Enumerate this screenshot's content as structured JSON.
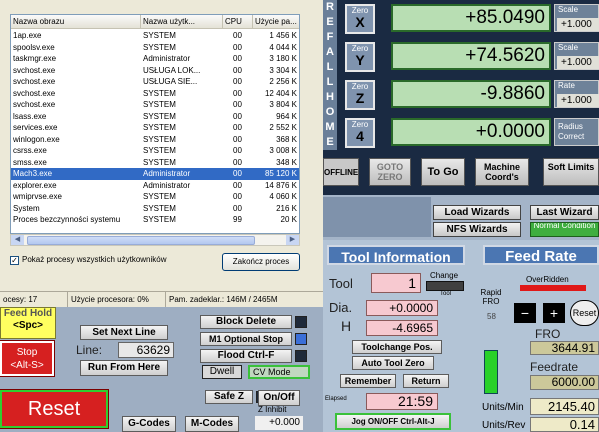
{
  "task_manager": {
    "columns": [
      "Nazwa obrazu",
      "Nazwa użytk...",
      "CPU",
      "Użycie pa..."
    ],
    "processes": [
      {
        "name": "1ap.exe",
        "user": "SYSTEM",
        "cpu": "00",
        "mem": "1 456 K"
      },
      {
        "name": "spoolsv.exe",
        "user": "SYSTEM",
        "cpu": "00",
        "mem": "4 044 K"
      },
      {
        "name": "taskmgr.exe",
        "user": "Administrator",
        "cpu": "00",
        "mem": "3 180 K"
      },
      {
        "name": "svchost.exe",
        "user": "USŁUGA LOK...",
        "cpu": "00",
        "mem": "3 304 K"
      },
      {
        "name": "svchost.exe",
        "user": "USŁUGA SIE...",
        "cpu": "00",
        "mem": "2 256 K"
      },
      {
        "name": "svchost.exe",
        "user": "SYSTEM",
        "cpu": "00",
        "mem": "12 404 K"
      },
      {
        "name": "svchost.exe",
        "user": "SYSTEM",
        "cpu": "00",
        "mem": "3 804 K"
      },
      {
        "name": "lsass.exe",
        "user": "SYSTEM",
        "cpu": "00",
        "mem": "964 K"
      },
      {
        "name": "services.exe",
        "user": "SYSTEM",
        "cpu": "00",
        "mem": "2 552 K"
      },
      {
        "name": "winlogon.exe",
        "user": "SYSTEM",
        "cpu": "00",
        "mem": "368 K"
      },
      {
        "name": "csrss.exe",
        "user": "SYSTEM",
        "cpu": "00",
        "mem": "3 008 K"
      },
      {
        "name": "smss.exe",
        "user": "SYSTEM",
        "cpu": "00",
        "mem": "348 K"
      },
      {
        "name": "Mach3.exe",
        "user": "Administrator",
        "cpu": "00",
        "mem": "85 120 K",
        "selected": true
      },
      {
        "name": "explorer.exe",
        "user": "Administrator",
        "cpu": "00",
        "mem": "14 876 K"
      },
      {
        "name": "wmiprvse.exe",
        "user": "SYSTEM",
        "cpu": "00",
        "mem": "4 060 K"
      },
      {
        "name": "System",
        "user": "SYSTEM",
        "cpu": "00",
        "mem": "216 K"
      },
      {
        "name": "Proces bezczynności systemu",
        "user": "SYSTEM",
        "cpu": "99",
        "mem": "20 K"
      }
    ],
    "show_all_label": "Pokaż procesy wszystkich użytkowników",
    "show_all_checked": "✓",
    "end_process_label": "Zakończ proces",
    "status": {
      "processes": "ocesy: 17",
      "cpu_usage": "Użycie procesora: 0%",
      "memory": "Pam. zadeklar.: 146M / 2465M"
    }
  },
  "mach3": {
    "ref_all_home": [
      "R",
      "E",
      "F",
      "A",
      "L",
      "L",
      "H",
      "O",
      "M",
      "E"
    ],
    "axes": [
      {
        "zero_label": "Zero",
        "axis": "X",
        "value": "+85.0490",
        "scale_label": "Scale",
        "scale": "+1.000"
      },
      {
        "zero_label": "Zero",
        "axis": "Y",
        "value": "+74.5620",
        "scale_label": "Scale",
        "scale": "+1.000"
      },
      {
        "zero_label": "Zero",
        "axis": "Z",
        "value": "-9.8860",
        "scale_label": "Rate",
        "scale": "+1.000"
      },
      {
        "zero_label": "Zero",
        "axis": "4",
        "value": "+0.0000",
        "scale_label": "Radius Correct",
        "scale": ""
      }
    ],
    "bottom_buttons": {
      "offline": "OFFLINE",
      "goto_zero": "GOTO ZERO",
      "to_go": "To Go",
      "machine_coords": "Machine Coord's",
      "soft_limits": "Soft Limits"
    },
    "wizards": {
      "load": "Load Wizards",
      "last": "Last Wizard",
      "nfs": "NFS Wizards",
      "normal_condition": "Normal Condition"
    },
    "left_panel": {
      "feed_hold": "Feed Hold",
      "feed_hold_key": "<Spc>",
      "stop": "Stop",
      "stop_key": "<Alt-S>",
      "reset": "Reset",
      "set_next_line": "Set Next Line",
      "line_label": "Line:",
      "line_value": "63629",
      "run_from_here": "Run From Here",
      "block_delete": "Block Delete",
      "optional_stop": "M1 Optional Stop",
      "flood": "Flood Ctrl-F",
      "dwell": "Dwell",
      "cv_mode": "CV Mode",
      "safe_z": "Safe Z",
      "on_off": "On/Off",
      "z_inhibit": "Z Inhibit",
      "z_inhibit_value": "+0.000",
      "gcodes": "G-Codes",
      "mcodes": "M-Codes"
    },
    "tool_info": {
      "header": "Tool Information",
      "tool_label": "Tool",
      "tool_value": "1",
      "change_label": "Change",
      "tool_small": "Tool",
      "dia_label": "Dia.",
      "dia_value": "+0.0000",
      "h_label": "H",
      "h_value": "-4.6965",
      "toolchange_pos": "Toolchange Pos.",
      "auto_tool_zero": "Auto Tool Zero",
      "remember": "Remember",
      "return": "Return",
      "elapsed_label": "Elapsed",
      "elapsed_value": "21:59",
      "jog_button": "Jog ON/OFF Ctrl-Alt-J"
    },
    "feed_rate": {
      "header": "Feed Rate",
      "overridden": "OverRidden",
      "rapid_fro": "Rapid FRO",
      "rapid_value": "58",
      "reset": "Reset",
      "fro_label": "FRO",
      "fro_value": "3644.91",
      "feedrate_label": "Feedrate",
      "feedrate_value": "6000.00",
      "units_min_label": "Units/Min",
      "units_min_value": "2145.40",
      "units_rev_label": "Units/Rev",
      "units_rev_value": "0.14"
    }
  }
}
